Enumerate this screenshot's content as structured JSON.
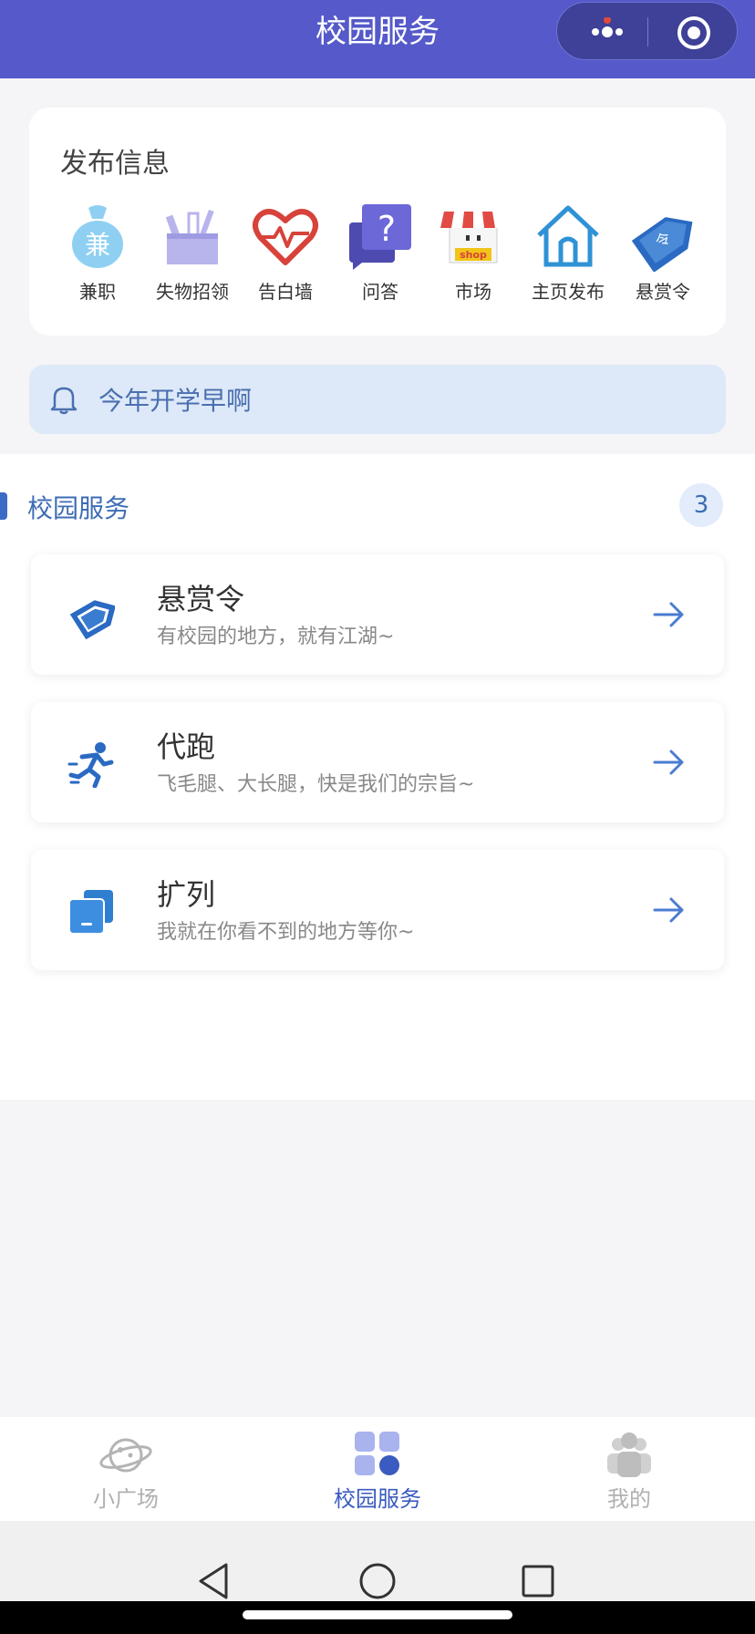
{
  "header": {
    "title": "校园服务"
  },
  "post_section": {
    "title": "发布信息",
    "items": [
      {
        "label": "兼职",
        "icon": "money-bag-icon"
      },
      {
        "label": "失物招领",
        "icon": "box-icon"
      },
      {
        "label": "告白墙",
        "icon": "heart-pulse-icon"
      },
      {
        "label": "问答",
        "icon": "question-chat-icon"
      },
      {
        "label": "市场",
        "icon": "shop-icon"
      },
      {
        "label": "主页发布",
        "icon": "home-icon"
      },
      {
        "label": "悬赏令",
        "icon": "tag-icon"
      }
    ]
  },
  "notice": {
    "text": "今年开学早啊"
  },
  "services": {
    "title": "校园服务",
    "count": "3",
    "items": [
      {
        "name": "悬赏令",
        "desc": "有校园的地方，就有江湖~",
        "icon": "tag-icon"
      },
      {
        "name": "代跑",
        "desc": "飞毛腿、大长腿，快是我们的宗旨~",
        "icon": "runner-icon"
      },
      {
        "name": "扩列",
        "desc": "我就在你看不到的地方等你~",
        "icon": "cards-icon"
      }
    ]
  },
  "tabbar": {
    "tabs": [
      {
        "label": "小广场",
        "icon": "planet-icon",
        "active": false
      },
      {
        "label": "校园服务",
        "icon": "grid-icon",
        "active": true
      },
      {
        "label": "我的",
        "icon": "people-icon",
        "active": false
      }
    ]
  },
  "colors": {
    "header": "#5559c9",
    "accent": "#3a6cc6",
    "notice_bg": "#dde9f8"
  }
}
